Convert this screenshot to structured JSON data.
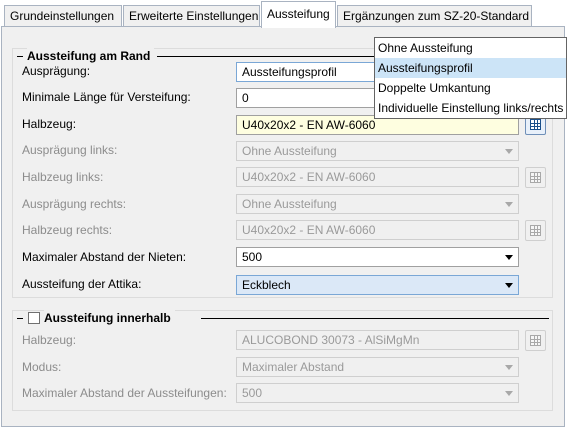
{
  "tabs": [
    {
      "label": "Grundeinstellungen",
      "active": false
    },
    {
      "label": "Erweiterte Einstellungen",
      "active": false
    },
    {
      "label": "Aussteifung",
      "active": true
    },
    {
      "label": "Ergänzungen zum SZ-20-Standard",
      "active": false
    }
  ],
  "group_rand": {
    "title": "Aussteifung am Rand",
    "rows": {
      "auspraegung": {
        "label": "Ausprägung:",
        "value": "Aussteifungsprofil"
      },
      "min_laenge": {
        "label": "Minimale Länge für Versteifung:",
        "value": "0"
      },
      "halbzeug": {
        "label": "Halbzeug:",
        "value": "U40x20x2 - EN AW-6060"
      },
      "auspraegung_links": {
        "label": "Ausprägung links:",
        "value": "Ohne Aussteifung"
      },
      "halbzeug_links": {
        "label": "Halbzeug links:",
        "value": "U40x20x2 - EN AW-6060"
      },
      "auspraegung_rechts": {
        "label": "Ausprägung rechts:",
        "value": "Ohne Aussteifung"
      },
      "halbzeug_rechts": {
        "label": "Halbzeug rechts:",
        "value": "U40x20x2 - EN AW-6060"
      },
      "max_abstand_nieten": {
        "label": "Maximaler Abstand der Nieten:",
        "value": "500"
      },
      "attika": {
        "label": "Aussteifung der Attika:",
        "value": "Eckblech"
      }
    }
  },
  "group_innerhalb": {
    "title": "Aussteifung innerhalb",
    "checked": false,
    "rows": {
      "halbzeug": {
        "label": "Halbzeug:",
        "value": "ALUCOBOND 30073 - AlSiMgMn"
      },
      "modus": {
        "label": "Modus:",
        "value": "Maximaler Abstand"
      },
      "max_abstand": {
        "label": "Maximaler Abstand der Aussteifungen:",
        "value": "500"
      }
    }
  },
  "dropdown": {
    "options": [
      "Ohne Aussteifung",
      "Aussteifungsprofil",
      "Doppelte Umkantung",
      "Individuelle Einstellung links/rechts"
    ],
    "selected": "Aussteifungsprofil"
  },
  "icons": {
    "browse": "table-grid-icon",
    "collapse": "minus-icon",
    "dropdown": "chevron-down-icon"
  },
  "colors": {
    "highlight": "#cce4f7",
    "required_field": "#fefee0",
    "combo_active": "#dbe8f7"
  }
}
